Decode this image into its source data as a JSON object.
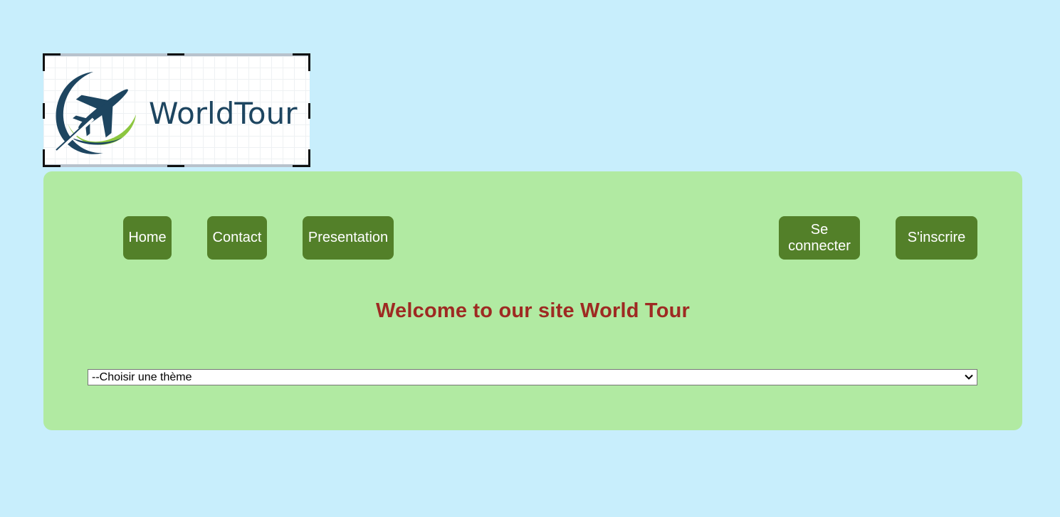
{
  "logo": {
    "text": "WorldTour",
    "colors": {
      "navy": "#1d4560",
      "green": "#8cc63f"
    }
  },
  "nav": {
    "items": [
      {
        "label": "Home"
      },
      {
        "label": "Contact"
      },
      {
        "label": "Presentation"
      }
    ],
    "auth": [
      {
        "label": "Se connecter"
      },
      {
        "label": "S'inscrire"
      }
    ]
  },
  "main": {
    "heading": "Welcome to our site World Tour",
    "theme_select": {
      "selected": "--Choisir une thème"
    }
  },
  "colors": {
    "page_bg": "#c8eefc",
    "panel_bg": "#b1eaa2",
    "button_bg": "#538029",
    "heading": "#9e2a22"
  }
}
